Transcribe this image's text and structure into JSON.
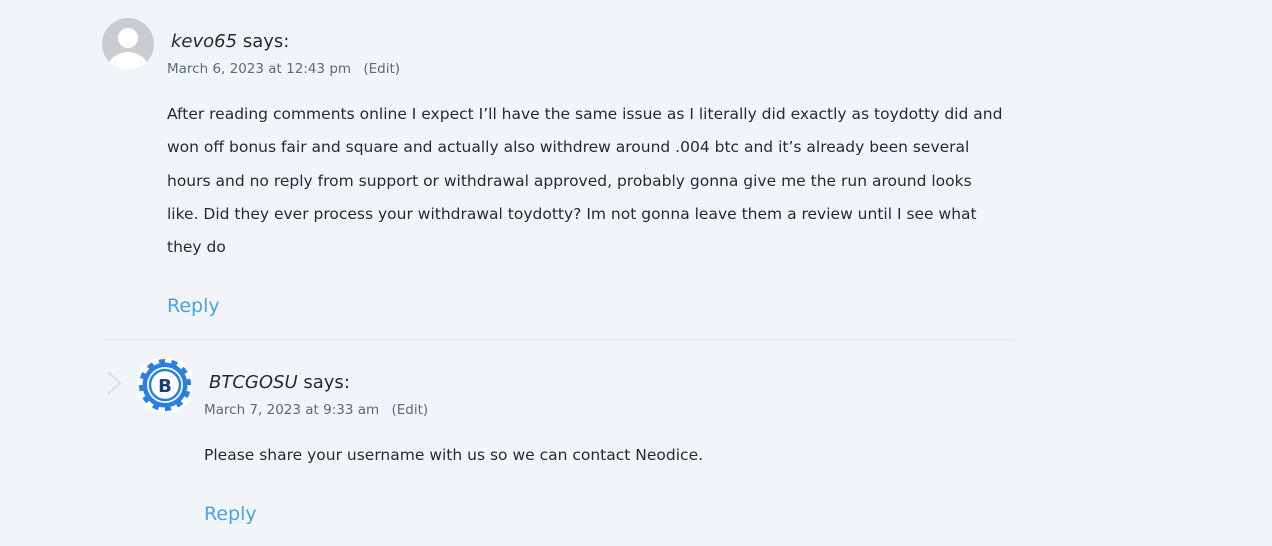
{
  "comments": [
    {
      "author": "kevo65",
      "says": "says:",
      "date": "March 6, 2023 at 12:43 pm",
      "edit": "(Edit)",
      "text": "After reading comments online I expect I’ll have the same issue as I literally did exactly as toydotty did and won off bonus fair and square and actually also withdrew around .004 btc and it’s already been several hours and no reply from support or withdrawal approved, probably gonna give me the run around looks like. Did they ever process your withdrawal toydotty? Im not gonna leave them a review until I see what they do",
      "reply": "Reply",
      "avatar": "default-user-avatar"
    },
    {
      "author": "BTCGOSU",
      "says": "says:",
      "date": "March 7, 2023 at 9:33 am",
      "edit": "(Edit)",
      "text": "Please share your username with us so we can contact Neodice.",
      "reply": "Reply",
      "avatar": "btcgosu-logo-avatar",
      "logo_letter": "B"
    }
  ],
  "colors": {
    "background": "#f1f5f9",
    "link": "#4aa3df",
    "logo_blue": "#2a7fe0",
    "avatar_gray": "#c9cdd1"
  }
}
